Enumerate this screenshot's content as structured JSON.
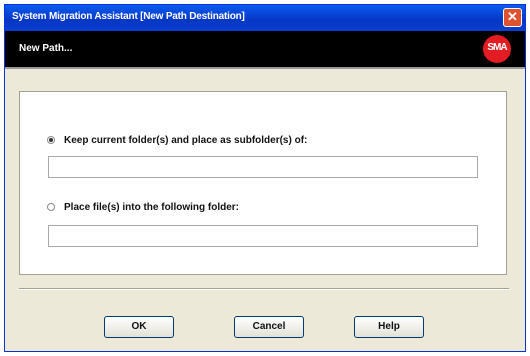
{
  "window": {
    "title": "System Migration Assistant [New Path Destination]",
    "close_symbol": "✕"
  },
  "header": {
    "title": "New Path...",
    "logo_glyph": "SMA"
  },
  "options": [
    {
      "label": "Keep current folder(s) and place as subfolder(s) of:",
      "selected": true,
      "value": ""
    },
    {
      "label": "Place file(s) into the following folder:",
      "selected": false,
      "value": ""
    }
  ],
  "buttons": {
    "ok": "OK",
    "cancel": "Cancel",
    "help": "Help"
  },
  "colors": {
    "titlebar": "#0a5bf0",
    "header_bg": "#000000",
    "logo": "#e31b23",
    "dialog_bg": "#ece9d8"
  }
}
